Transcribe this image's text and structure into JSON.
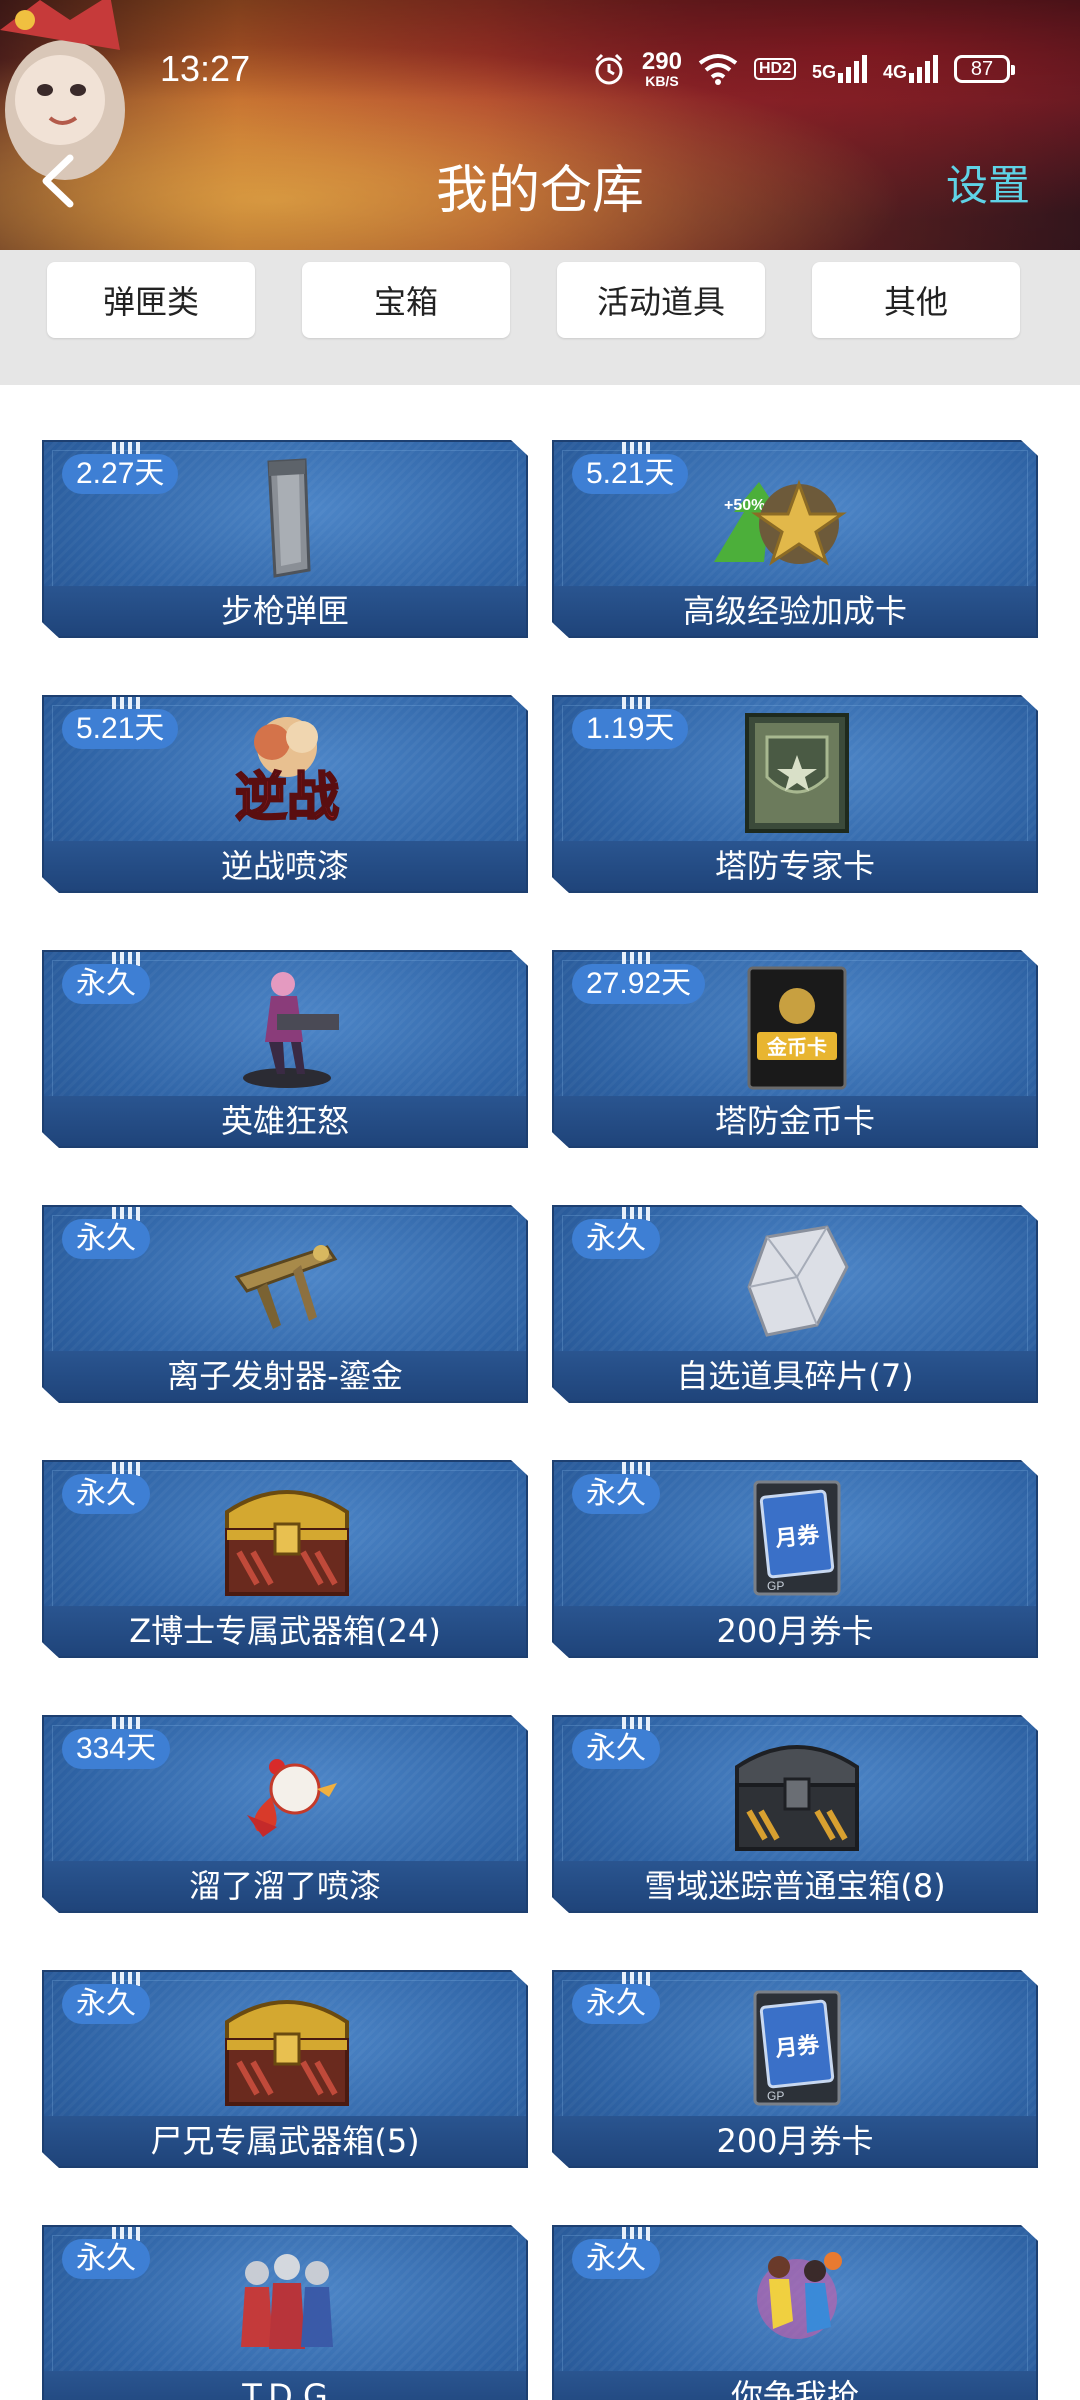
{
  "status_bar": {
    "time": "13:27",
    "net_speed": "290",
    "net_unit": "KB/S",
    "hd": "HD2",
    "signal_1": "5G",
    "signal_2": "4G",
    "battery": "87",
    "icons": [
      "alarm-icon",
      "wifi-icon"
    ]
  },
  "header": {
    "title": "我的仓库",
    "settings_label": "设置"
  },
  "tabs": [
    {
      "label": "弹匣类"
    },
    {
      "label": "宝箱"
    },
    {
      "label": "活动道具"
    },
    {
      "label": "其他"
    }
  ],
  "items": [
    {
      "name": "步枪弹匣",
      "duration": "2.27天",
      "icon": "rifle-magazine"
    },
    {
      "name": "高级经验加成卡",
      "duration": "5.21天",
      "icon": "exp-boost-star"
    },
    {
      "name": "逆战喷漆",
      "duration": "5.21天",
      "icon": "nizhan-spray"
    },
    {
      "name": "塔防专家卡",
      "duration": "1.19天",
      "icon": "tower-defense-expert-card"
    },
    {
      "name": "英雄狂怒",
      "duration": "永久",
      "icon": "hero-figure"
    },
    {
      "name": "塔防金币卡",
      "duration": "27.92天",
      "icon": "gold-coin-card"
    },
    {
      "name": "离子发射器-鎏金",
      "duration": "永久",
      "icon": "ion-launcher"
    },
    {
      "name": "自选道具碎片(7)",
      "duration": "永久",
      "icon": "crystal-shard"
    },
    {
      "name": "Z博士专属武器箱(24)",
      "duration": "永久",
      "icon": "gold-chest"
    },
    {
      "name": "200月券卡",
      "duration": "永久",
      "icon": "month-voucher-card"
    },
    {
      "name": "溜了溜了喷漆",
      "duration": "334天",
      "icon": "rooster-spray"
    },
    {
      "name": "雪域迷踪普通宝箱(8)",
      "duration": "永久",
      "icon": "dark-chest"
    },
    {
      "name": "尸兄专属武器箱(5)",
      "duration": "永久",
      "icon": "gold-chest"
    },
    {
      "name": "200月券卡",
      "duration": "永久",
      "icon": "month-voucher-card"
    },
    {
      "name": "T.D.G",
      "duration": "永久",
      "icon": "ultraman-trio"
    },
    {
      "name": "你争我抢",
      "duration": "永久",
      "icon": "basketball-players"
    }
  ],
  "item_image_text": {
    "exp_boost": "+50%",
    "nizhan": "逆战",
    "gold_card": "金币卡",
    "voucher": "月券",
    "gp": "GP"
  }
}
